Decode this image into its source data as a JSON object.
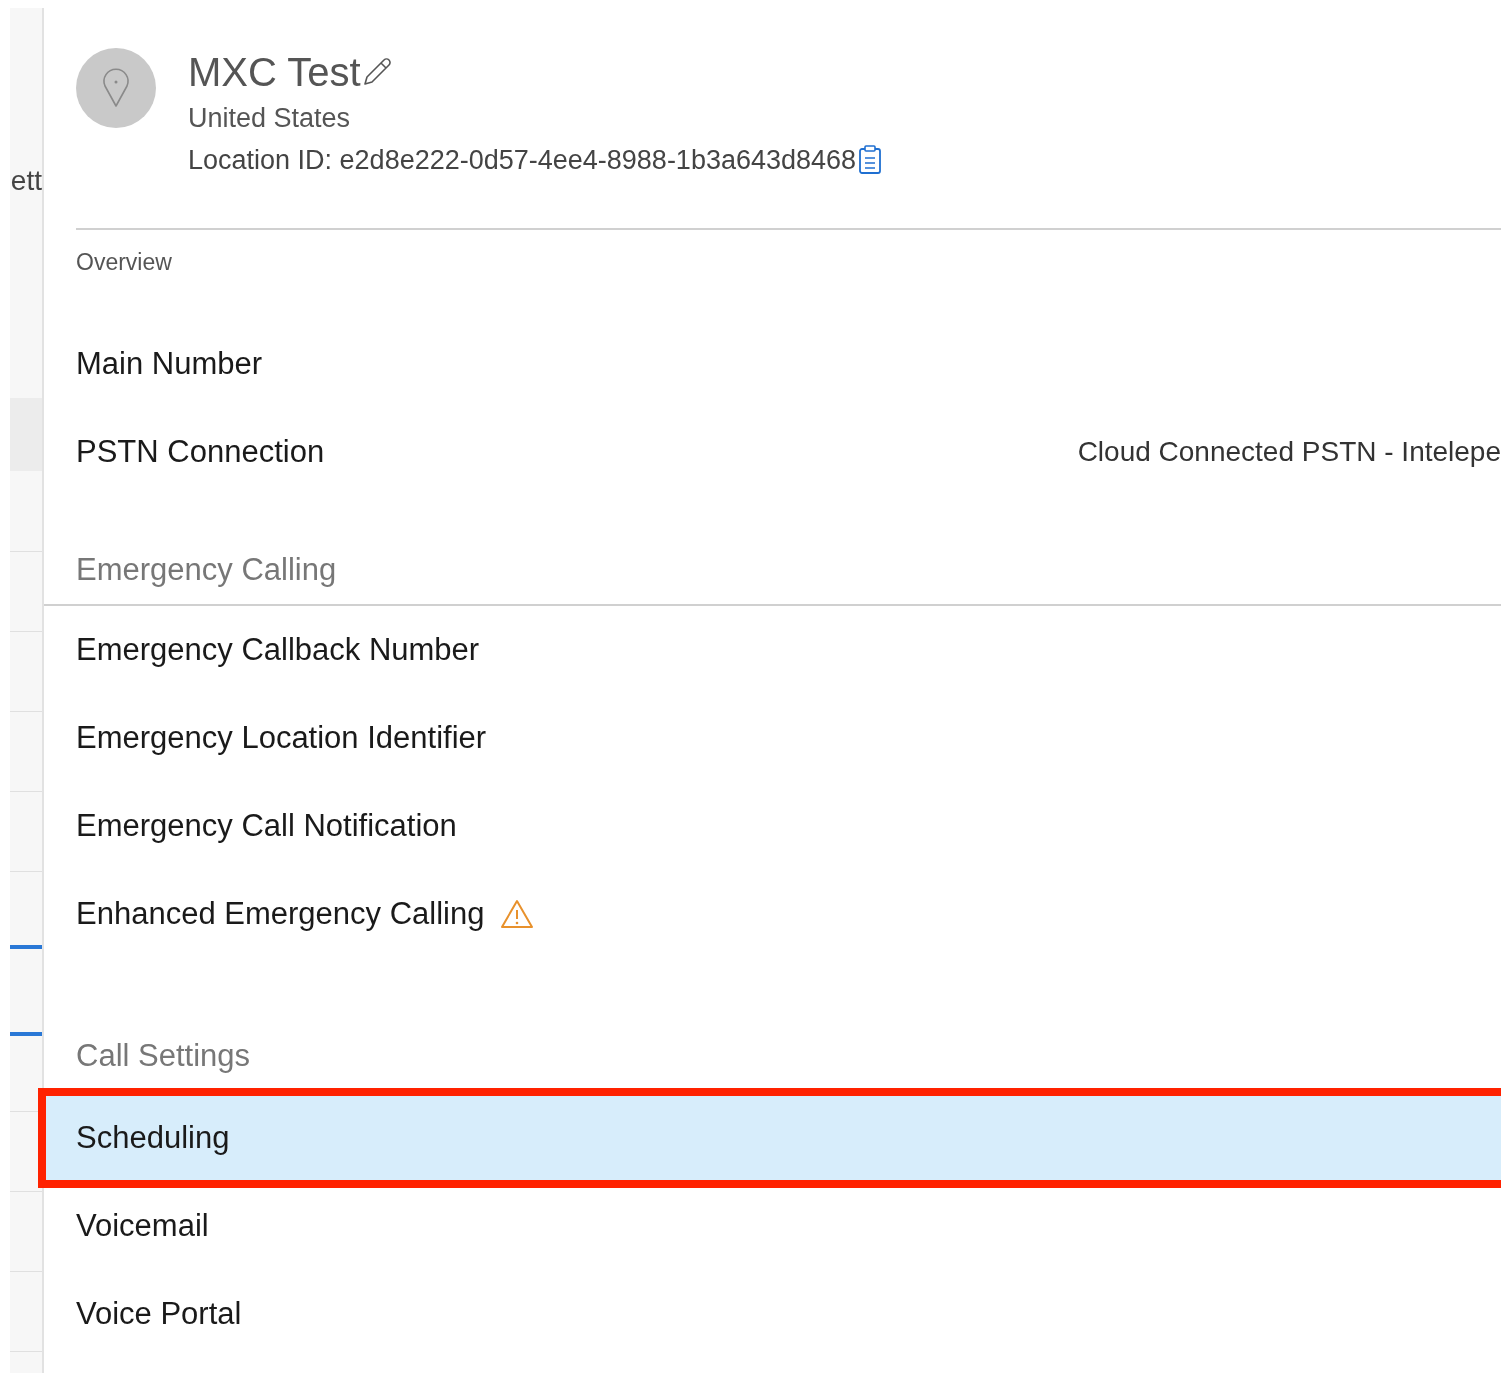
{
  "sidebar": {
    "label": "ett"
  },
  "location": {
    "name": "MXC Test",
    "country": "United States",
    "location_id": "Location ID: e2d8e222-0d57-4ee4-8988-1b3a643d8468"
  },
  "sections": [
    {
      "title": "Overview",
      "kind": "small",
      "divider": false,
      "items": [
        {
          "label": "Main Number",
          "selected": false
        },
        {
          "label": "PSTN Connection",
          "value": "Cloud Connected PSTN - Intelepe",
          "selected": false
        }
      ]
    },
    {
      "title": "Emergency Calling",
      "kind": "large",
      "divider": true,
      "items": [
        {
          "label": "Emergency Callback Number",
          "selected": false
        },
        {
          "label": "Emergency Location Identifier",
          "selected": false
        },
        {
          "label": "Emergency Call Notification",
          "selected": false
        },
        {
          "label": "Enhanced Emergency Calling",
          "warning": true,
          "selected": false
        }
      ]
    },
    {
      "title": "Call Settings",
      "kind": "large",
      "divider": false,
      "items": [
        {
          "label": "Scheduling",
          "selected": true
        },
        {
          "label": "Voicemail",
          "selected": false
        },
        {
          "label": "Voice Portal",
          "selected": false
        }
      ]
    }
  ]
}
